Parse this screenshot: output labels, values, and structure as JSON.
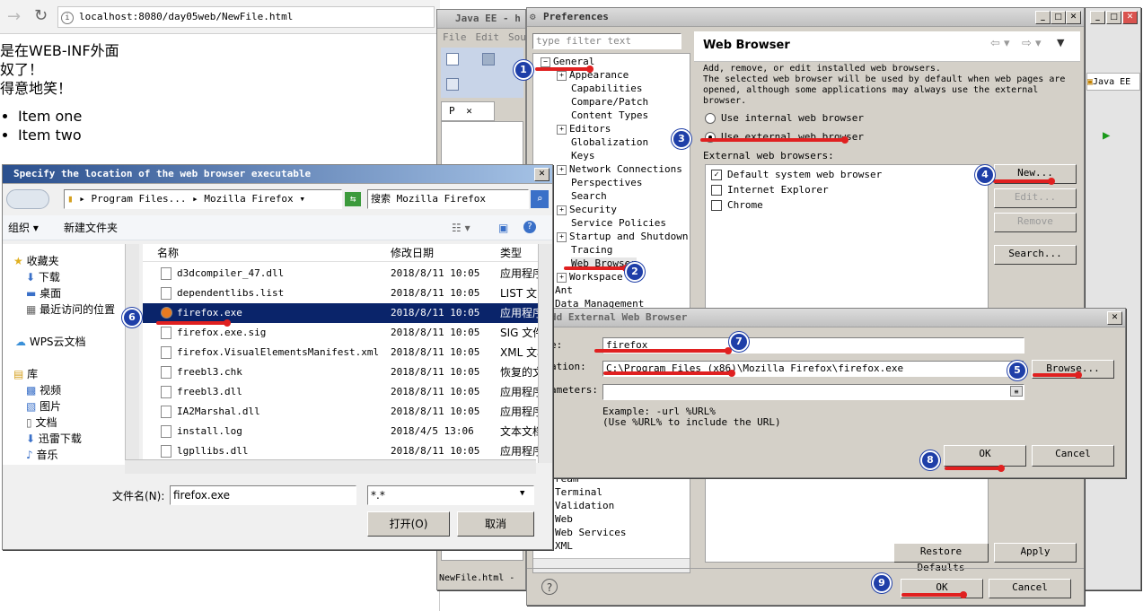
{
  "browser": {
    "url": "localhost:8080/day05web/NewFile.html",
    "content_lines": [
      "是在WEB-INF外面",
      "奴了！",
      "得意地笑！"
    ],
    "list_items": [
      "Item one",
      "Item two"
    ]
  },
  "eclipse": {
    "title": "Java EE - h",
    "menu": [
      "File",
      "Edit",
      "Sou"
    ],
    "view_tab": "P",
    "status_tab": "NewFile.html - "
  },
  "preferences": {
    "title": "Preferences",
    "filter_placeholder": "type filter text",
    "page_title": "Web Browser",
    "description": "Add, remove, or edit installed web browsers.\nThe selected web browser will be used by default when web pages are opened, although some applications may always use the external browser.",
    "radio_internal": "Use internal web browser",
    "radio_external": "Use external web browser",
    "external_label": "External web browsers:",
    "browsers": [
      "Default system web browser",
      "Internet Explorer",
      "Chrome"
    ],
    "buttons": {
      "new": "New...",
      "edit": "Edit...",
      "remove": "Remove",
      "search": "Search...",
      "restore": "Restore Defaults",
      "apply": "Apply",
      "ok": "OK",
      "cancel": "Cancel"
    },
    "perspective": "Java EE",
    "tree": {
      "general": "General",
      "general_children": [
        "Appearance",
        "Capabilities",
        "Compare/Patch",
        "Content Types",
        "Editors",
        "Globalization",
        "Keys",
        "Network Connections",
        "Perspectives",
        "Search",
        "Security",
        "Service Policies",
        "Startup and Shutdown",
        "Tracing",
        "Web Browser",
        "Workspace"
      ],
      "top_after": [
        "Ant",
        "Data Management"
      ],
      "bottom": [
        "ream",
        "Terminal",
        "Validation",
        "Web",
        "Web Services",
        "XML"
      ]
    }
  },
  "add_dialog": {
    "title": "dd External Web Browser",
    "name_label": "e:",
    "name_value": "firefox",
    "location_label": "ation:",
    "location_value": "C:\\Program Files (x86)\\Mozilla Firefox\\firefox.exe",
    "params_label": "ameters:",
    "params_value": "",
    "example_line1": "Example: -url %URL%",
    "example_line2": "(Use %URL% to include the URL)",
    "browse": "Browse...",
    "ok": "OK",
    "cancel": "Cancel"
  },
  "file_dialog": {
    "title": "Specify the location of the web browser executable",
    "path": [
      "Program Files...",
      "Mozilla Firefox"
    ],
    "search_placeholder": "搜索 Mozilla Firefox",
    "organize": "组织",
    "new_folder": "新建文件夹",
    "nav": {
      "favorites": "收藏夹",
      "favorites_items": [
        "下载",
        "桌面",
        "最近访问的位置"
      ],
      "wps": "WPS云文档",
      "library": "库",
      "library_items": [
        "视频",
        "图片",
        "文档",
        "迅雷下载",
        "音乐"
      ]
    },
    "columns": [
      "名称",
      "修改日期",
      "类型"
    ],
    "files": [
      {
        "name": "d3dcompiler_47.dll",
        "date": "2018/8/11 10:05",
        "type": "应用程序"
      },
      {
        "name": "dependentlibs.list",
        "date": "2018/8/11 10:05",
        "type": "LIST 文"
      },
      {
        "name": "firefox.exe",
        "date": "2018/8/11 10:05",
        "type": "应用程序"
      },
      {
        "name": "firefox.exe.sig",
        "date": "2018/8/11 10:05",
        "type": "SIG 文件"
      },
      {
        "name": "firefox.VisualElementsManifest.xml",
        "date": "2018/8/11 10:05",
        "type": "XML 文档"
      },
      {
        "name": "freebl3.chk",
        "date": "2018/8/11 10:05",
        "type": "恢复的文"
      },
      {
        "name": "freebl3.dll",
        "date": "2018/8/11 10:05",
        "type": "应用程序"
      },
      {
        "name": "IA2Marshal.dll",
        "date": "2018/8/11 10:05",
        "type": "应用程序"
      },
      {
        "name": "install.log",
        "date": "2018/4/5 13:06",
        "type": "文本文档"
      },
      {
        "name": "lgpllibs.dll",
        "date": "2018/8/11 10:05",
        "type": "应用程序"
      }
    ],
    "filename_label": "文件名(N):",
    "filename_value": "firefox.exe",
    "filter_value": "*.*",
    "open": "打开(O)",
    "cancel": "取消"
  },
  "badges": [
    "1",
    "2",
    "3",
    "4",
    "5",
    "6",
    "7",
    "8",
    "9"
  ],
  "colors": {
    "annotation_red": "#e02020",
    "badge_blue": "#1f3fa8",
    "selection": "#0a246a"
  }
}
